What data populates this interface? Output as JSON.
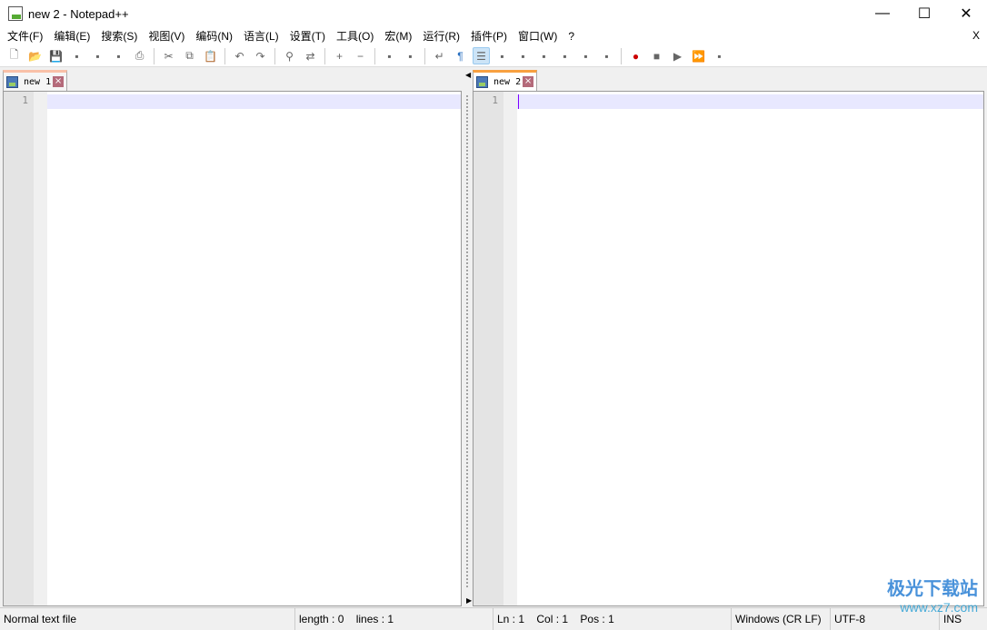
{
  "window": {
    "title": "new 2 - Notepad++",
    "minimize": "—",
    "maximize": "☐",
    "close": "✕"
  },
  "menu": {
    "items": [
      "文件(F)",
      "编辑(E)",
      "搜索(S)",
      "视图(V)",
      "编码(N)",
      "语言(L)",
      "设置(T)",
      "工具(O)",
      "宏(M)",
      "运行(R)",
      "插件(P)",
      "窗口(W)",
      "?"
    ],
    "close": "X"
  },
  "toolbar": {
    "groups": [
      [
        "new-file",
        "open-file",
        "save",
        "save-all",
        "close",
        "close-all",
        "print"
      ],
      [
        "cut",
        "copy",
        "paste"
      ],
      [
        "undo",
        "redo"
      ],
      [
        "find",
        "replace"
      ],
      [
        "zoom-in",
        "zoom-out"
      ],
      [
        "sync-vertical",
        "sync-horizontal"
      ],
      [
        "word-wrap",
        "show-all-chars",
        "indent-guide",
        "user-language",
        "document-map",
        "document-list",
        "function-list",
        "folder-workspace",
        "monitoring"
      ],
      [
        "record-macro",
        "stop-record",
        "play-macro",
        "run-macro-multiple",
        "save-macro"
      ]
    ],
    "active": "indent-guide"
  },
  "left_pane": {
    "tab": {
      "label": "new 1",
      "close": "×"
    },
    "line_numbers": [
      "1"
    ]
  },
  "right_pane": {
    "tab": {
      "label": "new 2",
      "close": "×"
    },
    "line_numbers": [
      "1"
    ]
  },
  "status": {
    "file_type": "Normal text file",
    "length": "length : 0",
    "lines": "lines : 1",
    "ln": "Ln : 1",
    "col": "Col : 1",
    "pos": "Pos : 1",
    "eol": "Windows (CR LF)",
    "encoding": "UTF-8",
    "mode": "INS"
  },
  "watermark": {
    "name": "极光下载站",
    "url": "www.xz7.com"
  }
}
